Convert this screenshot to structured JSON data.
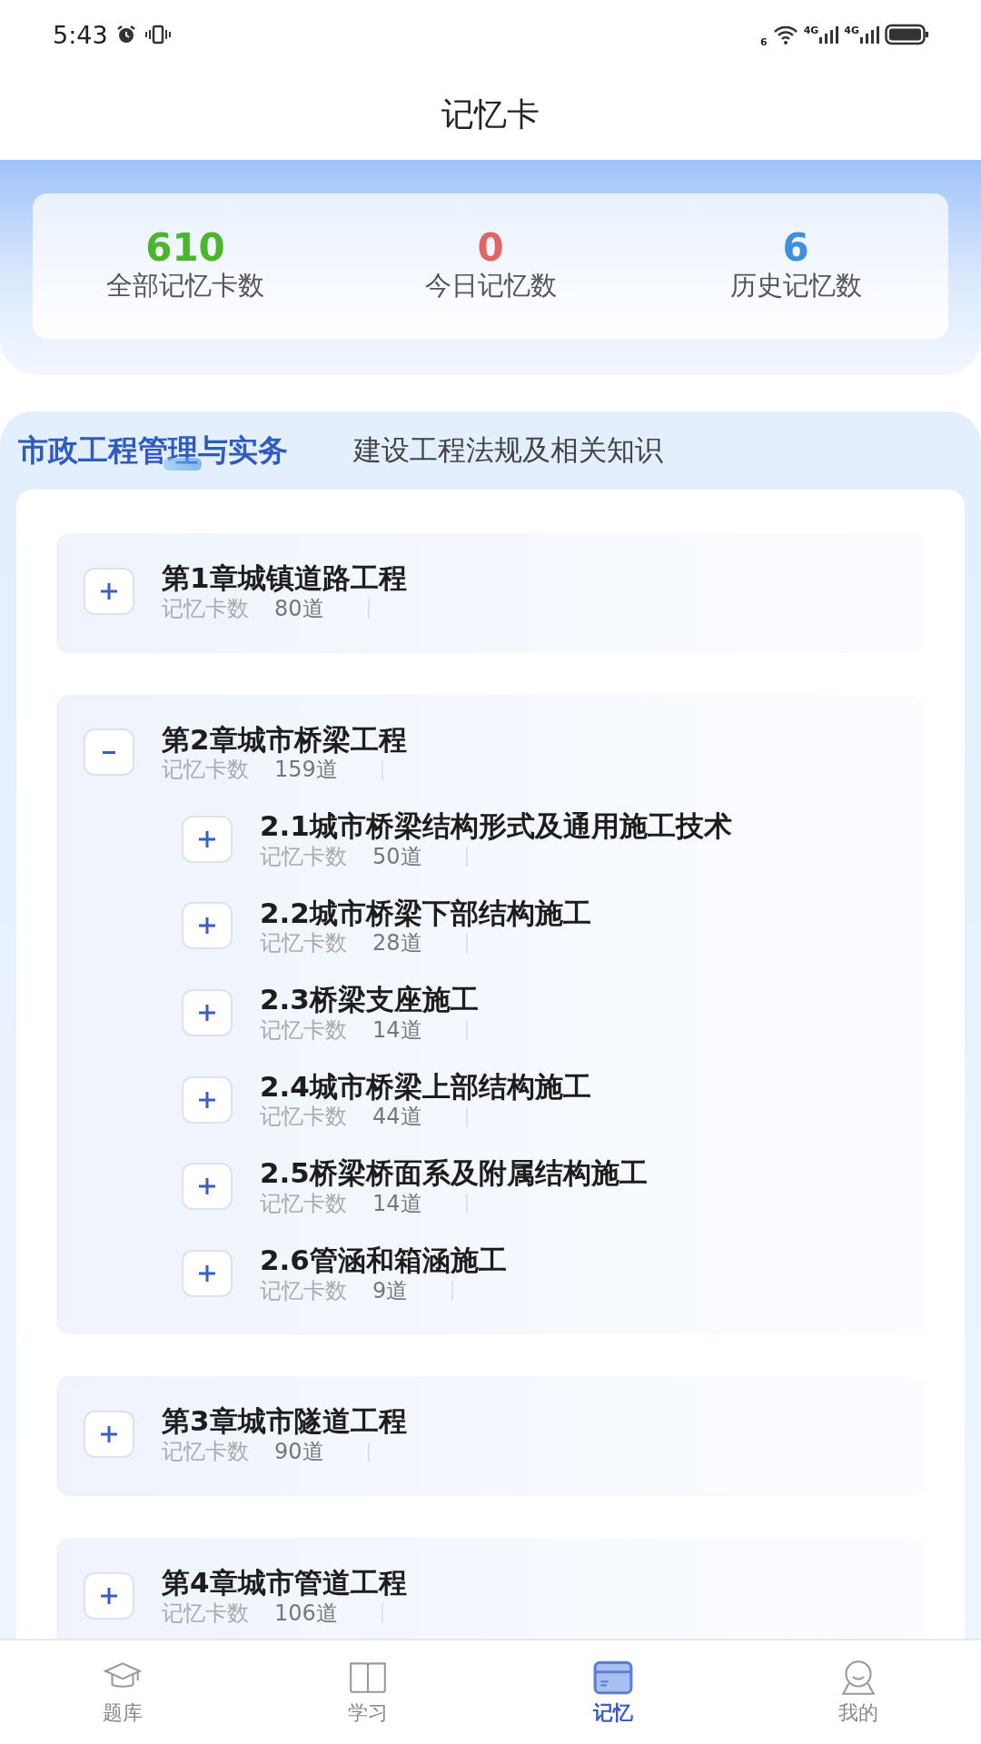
{
  "status_bar": {
    "time": "5:43",
    "wifi_label": "6",
    "network_labels": [
      "4G",
      "4G"
    ]
  },
  "title": "记忆卡",
  "stats": [
    {
      "value": "610",
      "label": "全部记忆卡数",
      "color": "#4cb52e"
    },
    {
      "value": "0",
      "label": "今日记忆数",
      "color": "#e06666"
    },
    {
      "value": "6",
      "label": "历史记忆数",
      "color": "#3d8fe0"
    }
  ],
  "tabs": [
    {
      "label": "市政工程管理与实务",
      "selected": true
    },
    {
      "label": "建设工程法规及相关知识",
      "selected": false
    }
  ],
  "chapters": [
    {
      "title": "第1章城镇道路工程",
      "count_label": "记忆卡数",
      "count": "80道",
      "expanded": false
    },
    {
      "title": "第2章城市桥梁工程",
      "count_label": "记忆卡数",
      "count": "159道",
      "expanded": true,
      "children": [
        {
          "title": "2.1城市桥梁结构形式及通用施工技术",
          "count_label": "记忆卡数",
          "count": "50道",
          "expanded": false
        },
        {
          "title": "2.2城市桥梁下部结构施工",
          "count_label": "记忆卡数",
          "count": "28道",
          "expanded": false
        },
        {
          "title": "2.3桥梁支座施工",
          "count_label": "记忆卡数",
          "count": "14道",
          "expanded": false
        },
        {
          "title": "2.4城市桥梁上部结构施工",
          "count_label": "记忆卡数",
          "count": "44道",
          "expanded": false
        },
        {
          "title": "2.5桥梁桥面系及附属结构施工",
          "count_label": "记忆卡数",
          "count": "14道",
          "expanded": false
        },
        {
          "title": "2.6管涵和箱涵施工",
          "count_label": "记忆卡数",
          "count": "9道",
          "expanded": false
        }
      ]
    },
    {
      "title": "第3章城市隧道工程",
      "count_label": "记忆卡数",
      "count": "90道",
      "expanded": false
    },
    {
      "title": "第4章城市管道工程",
      "count_label": "记忆卡数",
      "count": "106道",
      "expanded": false
    }
  ],
  "nav": [
    {
      "kind": "cap",
      "label": "题库",
      "selected": false
    },
    {
      "kind": "book",
      "label": "学习",
      "selected": false
    },
    {
      "kind": "card",
      "label": "记忆",
      "selected": true
    },
    {
      "kind": "person",
      "label": "我的",
      "selected": false
    }
  ]
}
